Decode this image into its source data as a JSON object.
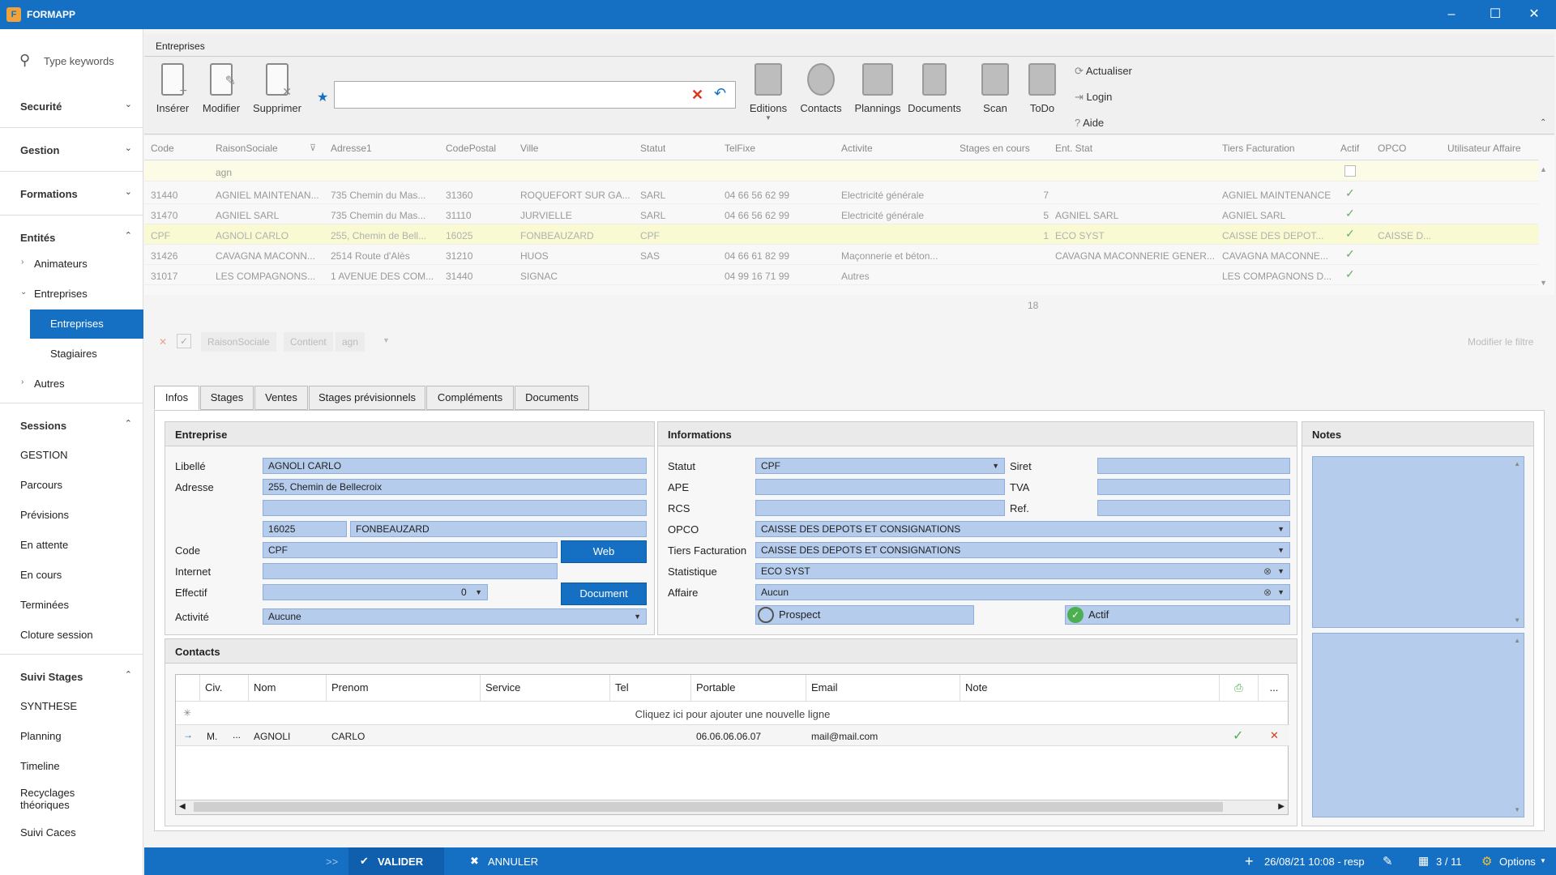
{
  "app": {
    "title": "FORMAPP",
    "window_controls": [
      "minimize-icon",
      "maximize-icon",
      "close-icon"
    ]
  },
  "sidebar": {
    "search_placeholder": "Type keywords",
    "groups": [
      {
        "label": "Securité",
        "expanded": false
      },
      {
        "label": "Gestion",
        "expanded": false
      },
      {
        "label": "Formations",
        "expanded": false
      },
      {
        "label": "Entités",
        "expanded": true
      },
      {
        "label": "Sessions",
        "expanded": true
      },
      {
        "label": "Suivi Stages",
        "expanded": true
      }
    ],
    "entites_items": [
      "Animateurs",
      "Entreprises",
      "Entreprises",
      "Stagiaires",
      "Autres"
    ],
    "sessions_items": [
      "GESTION",
      "Parcours",
      "Prévisions",
      "En attente",
      "En cours",
      "Terminées",
      "Cloture session"
    ],
    "suivi_items": [
      "SYNTHESE",
      "Planning",
      "Timeline",
      "Recyclages théoriques",
      "Suivi Caces"
    ]
  },
  "doc_tab": "Entreprises",
  "ribbon": {
    "insert": "Insérer",
    "modify": "Modifier",
    "delete": "Supprimer",
    "editions": "Editions",
    "contacts": "Contacts",
    "plannings": "Plannings",
    "documents": "Documents",
    "scan": "Scan",
    "todo": "ToDo",
    "refresh": "Actualiser",
    "login": "Login",
    "help": "Aide",
    "search_value": ""
  },
  "grid": {
    "columns": [
      "Code",
      "RaisonSociale",
      "Adresse1",
      "CodePostal",
      "Ville",
      "Statut",
      "TelFixe",
      "Activite",
      "Stages en cours",
      "Ent. Stat",
      "Tiers Facturation",
      "Actif",
      "OPCO",
      "Utilisateur Affaire"
    ],
    "filter_value": "agn",
    "rows": [
      {
        "code": "31440",
        "raison": "AGNIEL MAINTENAN...",
        "adresse": "735 Chemin du Mas...",
        "cp": "31360",
        "ville": "ROQUEFORT SUR GA...",
        "statut": "SARL",
        "tel": "04 66 56 62 99",
        "activite": "Electricité générale",
        "stages": "7",
        "entstat": "",
        "tiers": "AGNIEL MAINTENANCE",
        "opco": ""
      },
      {
        "code": "31470",
        "raison": "AGNIEL SARL",
        "adresse": "735 Chemin du Mas...",
        "cp": "31110",
        "ville": "JURVIELLE",
        "statut": "SARL",
        "tel": "04 66 56 62 99",
        "activite": "Electricité générale",
        "stages": "5",
        "entstat": "AGNIEL SARL",
        "tiers": "AGNIEL SARL",
        "opco": ""
      },
      {
        "code": "CPF",
        "raison": "AGNOLI CARLO",
        "adresse": "255, Chemin de Bell...",
        "cp": "16025",
        "ville": "FONBEAUZARD",
        "statut": "CPF",
        "tel": "",
        "activite": "",
        "stages": "1",
        "entstat": "ECO SYST",
        "tiers": "CAISSE DES DEPOT...",
        "opco": "CAISSE D..."
      },
      {
        "code": "31426",
        "raison": "CAVAGNA MACONN...",
        "adresse": "2514 Route d'Alès",
        "cp": "31210",
        "ville": "HUOS",
        "statut": "SAS",
        "tel": "04 66 61 82 99",
        "activite": "Maçonnerie et béton...",
        "stages": "",
        "entstat": "CAVAGNA MACONNERIE GENER...",
        "tiers": "CAVAGNA MACONNE...",
        "opco": ""
      },
      {
        "code": "31017",
        "raison": "LES COMPAGNONS...",
        "adresse": "1 AVENUE DES COM...",
        "cp": "31440",
        "ville": "SIGNAC",
        "statut": "",
        "tel": "04 99 16 71 99",
        "activite": "Autres",
        "stages": "",
        "entstat": "",
        "tiers": "LES COMPAGNONS D...",
        "opco": ""
      }
    ],
    "total": "18"
  },
  "filterbar": {
    "field": "RaisonSociale",
    "op": "Contient",
    "value": "agn",
    "edit": "Modifier le filtre"
  },
  "tabs": [
    "Infos",
    "Stages",
    "Ventes",
    "Stages prévisionnels",
    "Compléments",
    "Documents"
  ],
  "entreprise": {
    "title": "Entreprise",
    "libelle_label": "Libellé",
    "libelle": "AGNOLI CARLO",
    "adresse_label": "Adresse",
    "adresse1": "255, Chemin de Bellecroix",
    "adresse2": "",
    "cp": "16025",
    "ville": "FONBEAUZARD",
    "code_label": "Code",
    "code": "CPF",
    "web": "Web",
    "internet_label": "Internet",
    "internet": "",
    "effectif_label": "Effectif",
    "effectif": "0",
    "document": "Document",
    "activite_label": "Activité",
    "activite": "Aucune"
  },
  "informations": {
    "title": "Informations",
    "statut_label": "Statut",
    "statut": "CPF",
    "siret_label": "Siret",
    "siret": "",
    "ape_label": "APE",
    "ape": "",
    "tva_label": "TVA",
    "tva": "",
    "rcs_label": "RCS",
    "rcs": "",
    "ref_label": "Ref.",
    "ref": "",
    "opco_label": "OPCO",
    "opco": "CAISSE DES DEPOTS ET CONSIGNATIONS",
    "tiers_label": "Tiers Facturation",
    "tiers": "CAISSE DES DEPOTS ET CONSIGNATIONS",
    "stat_label": "Statistique",
    "stat": "ECO SYST",
    "affaire_label": "Affaire",
    "affaire": "Aucun",
    "prospect": "Prospect",
    "actif": "Actif"
  },
  "notes": {
    "title": "Notes"
  },
  "contacts": {
    "title": "Contacts",
    "columns": [
      "Civ.",
      "Nom",
      "Prenom",
      "Service",
      "Tel",
      "Portable",
      "Email",
      "Note"
    ],
    "new_row": "Cliquez ici pour ajouter une nouvelle ligne",
    "rows": [
      {
        "civ": "M.",
        "nom": "AGNOLI",
        "prenom": "CARLO",
        "service": "",
        "tel": "",
        "portable": "06.06.06.06.07",
        "email": "mail@mail.com",
        "note": ""
      }
    ]
  },
  "statusbar": {
    "expand": ">>",
    "valider": "VALIDER",
    "annuler": "ANNULER",
    "datetime": "26/08/21 10:08 - resp",
    "pages": "3 / 11",
    "options": "Options"
  }
}
